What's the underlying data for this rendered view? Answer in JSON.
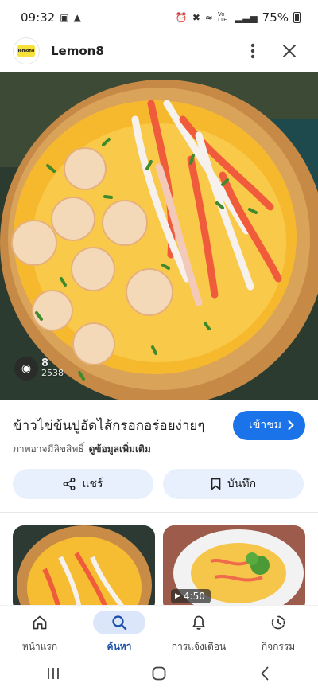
{
  "status": {
    "time": "09:32",
    "battery": "75%",
    "network_label": "Voo LTE"
  },
  "app": {
    "logo_text": "lemon8",
    "name": "Lemon8"
  },
  "hero": {
    "watermark": "8",
    "watermark_count": "2538"
  },
  "post": {
    "title": "ข้าวไข่ข้นปูอัดไส้กรอกอร่อยง่ายๆ",
    "visit_label": "เข้าชม",
    "source_disclaimer": "ภาพอาจมีลิขสิทธิ์",
    "more_info": "ดูข้อมูลเพิ่มเติม"
  },
  "actions": {
    "share_label": "แชร์",
    "save_label": "บันทึก"
  },
  "thumbnails": [
    {
      "name": "thumb-omelette-bowl"
    },
    {
      "name": "thumb-omelette-plate",
      "duration": "4:50"
    }
  ],
  "nav": [
    {
      "label": "หน้าแรก",
      "icon": "home-icon",
      "active": false
    },
    {
      "label": "ค้นหา",
      "icon": "search-icon",
      "active": true
    },
    {
      "label": "การแจ้งเตือน",
      "icon": "bell-icon",
      "active": false
    },
    {
      "label": "กิจกรรม",
      "icon": "activity-icon",
      "active": false
    }
  ],
  "colors": {
    "accent": "#1a73e8",
    "chip_bg": "#e8f0fe",
    "nav_active_bg": "#dbe6fb"
  }
}
